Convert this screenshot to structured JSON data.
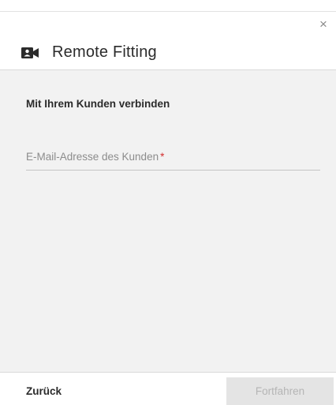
{
  "dialog": {
    "title": "Remote Fitting",
    "close_glyph": "×",
    "title_icon": "video-camera-icon"
  },
  "form": {
    "section_title": "Mit Ihrem Kunden verbinden",
    "email_label": "E-Mail-Adresse des Kunden",
    "required_marker": "*",
    "email_value": ""
  },
  "footer": {
    "back_label": "Zurück",
    "next_label": "Fortfahren",
    "next_enabled": false
  },
  "colors": {
    "required": "#d32f2f",
    "body_background": "#f2f2f2",
    "disabled_button": "#e4e4e4"
  }
}
